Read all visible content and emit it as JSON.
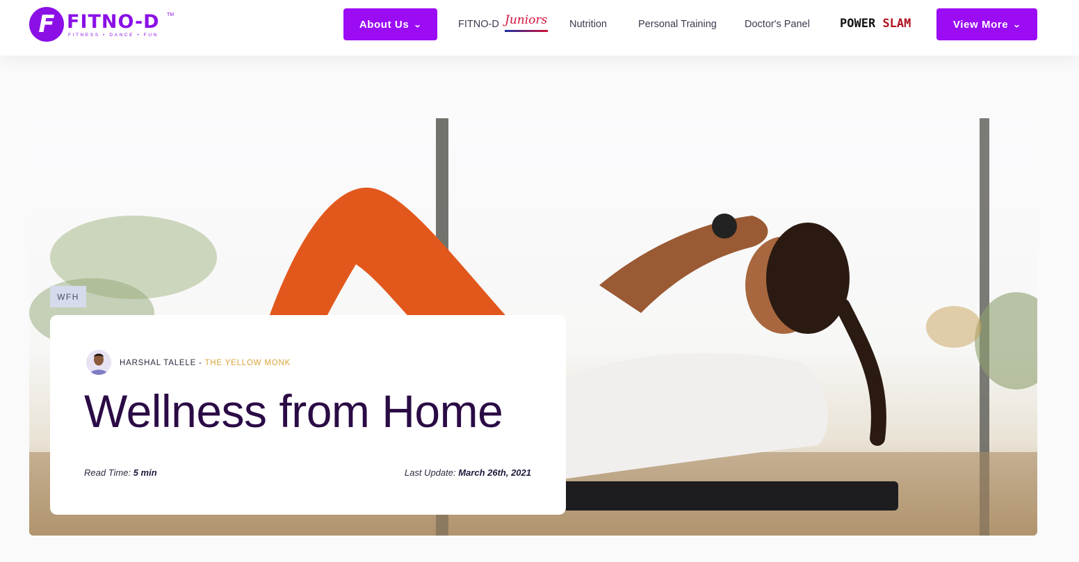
{
  "header": {
    "logo": {
      "text": "FITNO-D",
      "tm": "TM",
      "tagline": "FITNESS • DANCE • FUN"
    },
    "nav": {
      "about_us": "About Us",
      "fitnod_juniors_prefix": "FITNO-D",
      "fitnod_juniors_script": "Juniors",
      "nutrition": "Nutrition",
      "personal_training": "Personal Training",
      "doctors_panel": "Doctor's Panel",
      "power_slam_part1": "POWER",
      "power_slam_part2": "SLAM",
      "view_more": "View More"
    },
    "icons": {
      "dropdown": "chevron-down-icon"
    }
  },
  "article": {
    "category": "WFH",
    "author_name": "HARSHAL TALELE",
    "author_separator": " - ",
    "author_tagline": "THE YELLOW MONK",
    "title": "Wellness from Home",
    "read_time_label": "Read Time:",
    "read_time_value": "5 min",
    "last_update_label": "Last Update:",
    "last_update_value": "March 26th, 2021"
  },
  "colors": {
    "brand_purple": "#9b0cf5",
    "title_color": "#2b0b45",
    "author_accent": "#d9a43a"
  }
}
